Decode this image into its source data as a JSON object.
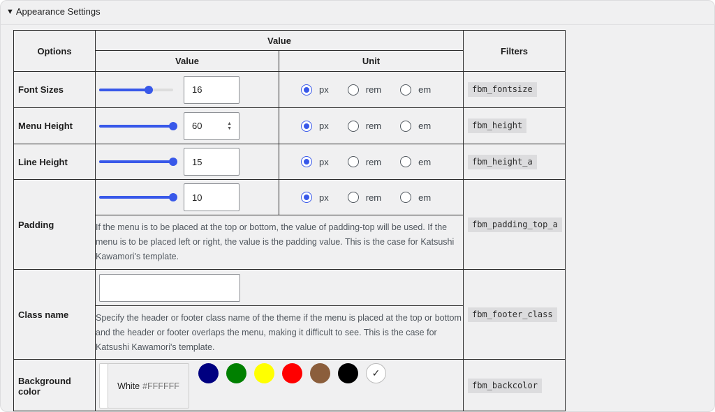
{
  "panel": {
    "title": "Appearance Settings"
  },
  "headers": {
    "options": "Options",
    "value_group": "Value",
    "value": "Value",
    "unit": "Unit",
    "filters": "Filters"
  },
  "units": [
    "px",
    "rem",
    "em"
  ],
  "colors": {
    "accent": "#3858e9"
  },
  "rows": {
    "font_sizes": {
      "label": "Font Sizes",
      "value": "16",
      "slider_fraction": 0.67,
      "unit_selected": "px",
      "filter": "fbm_fontsize"
    },
    "menu_height": {
      "label": "Menu Height",
      "value": "60",
      "slider_fraction": 1.0,
      "unit_selected": "px",
      "filter": "fbm_height"
    },
    "line_height": {
      "label": "Line Height",
      "value": "15",
      "slider_fraction": 1.0,
      "unit_selected": "px",
      "filter": "fbm_height_a"
    },
    "padding": {
      "label": "Padding",
      "value": "10",
      "slider_fraction": 1.0,
      "unit_selected": "px",
      "filter": "fbm_padding_top_a",
      "description": "If the menu is to be placed at the top or bottom, the value of padding-top will be used. If the menu is to be placed left or right, the value is the padding value. This is the case for Katsushi Kawamori's template."
    },
    "class_name": {
      "label": "Class name",
      "value": "",
      "filter": "fbm_footer_class",
      "description": "Specify the header or footer class name of the theme if the menu is placed at the top or bottom and the header or footer overlaps the menu, making it difficult to see. This is the case for Katsushi Kawamori's template."
    },
    "background_color": {
      "label": "Background color",
      "filter": "fbm_backcolor",
      "current_name": "White",
      "current_hex": "#FFFFFF",
      "palette": [
        "#000080",
        "#008000",
        "#ffff00",
        "#ff0000",
        "#8b5e3c",
        "#000000",
        "#ffffff"
      ],
      "selected_index": 6
    }
  }
}
